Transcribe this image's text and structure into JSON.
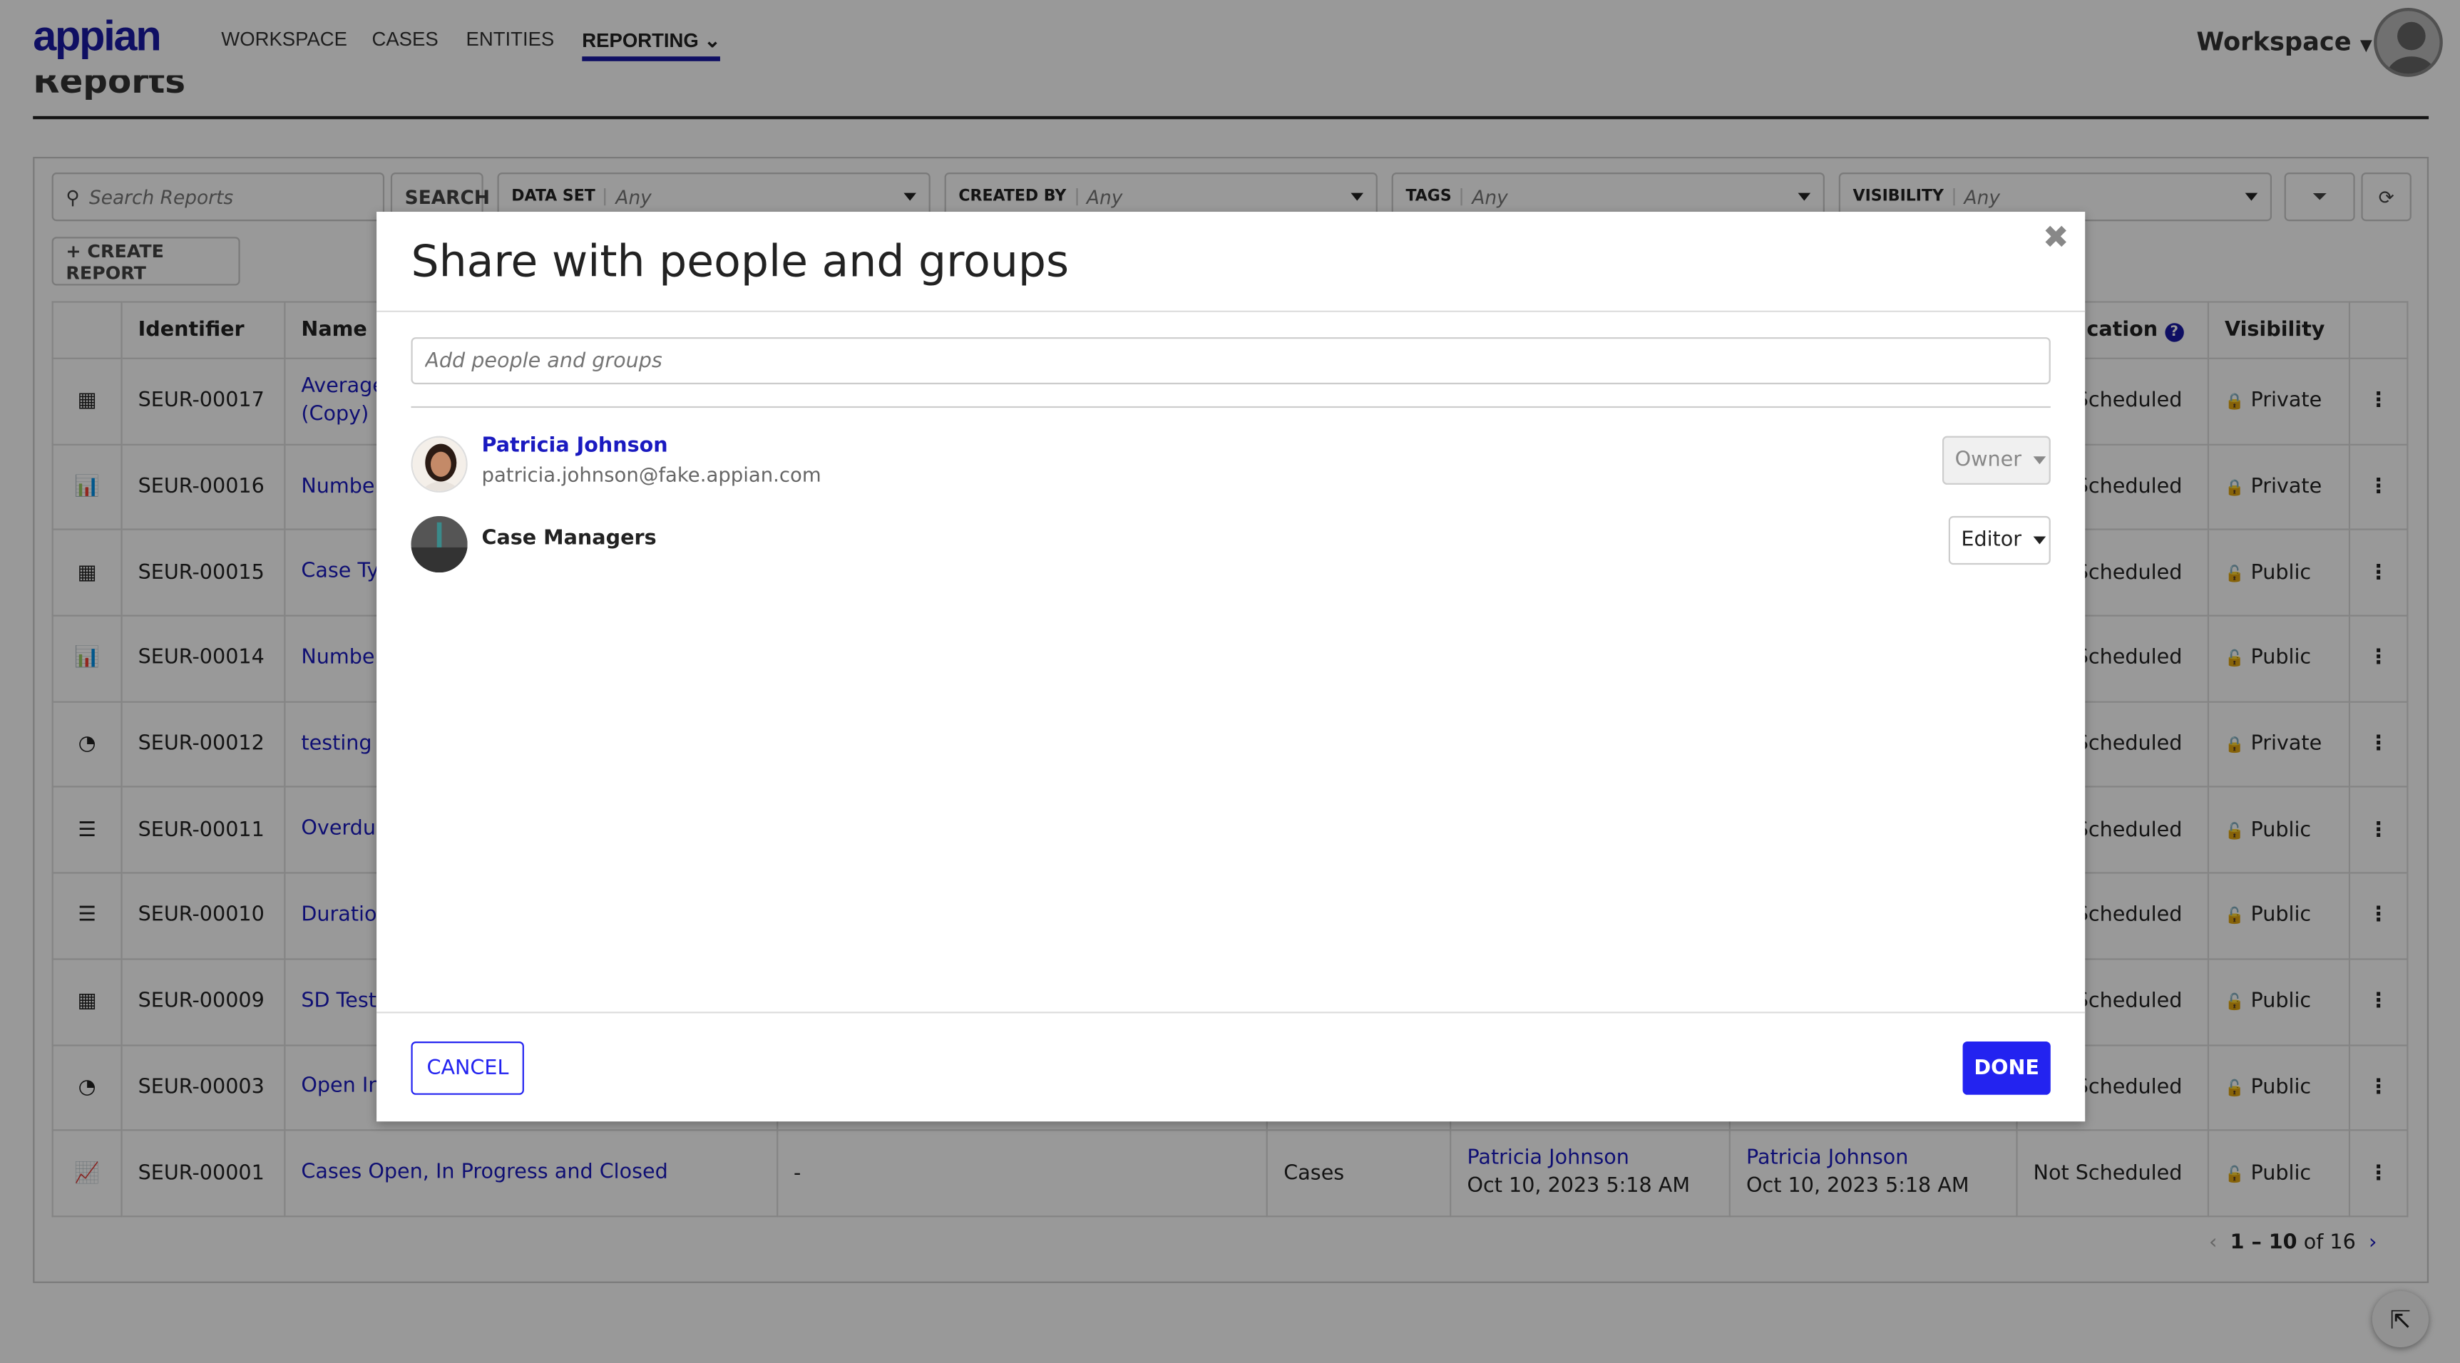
{
  "header": {
    "logo": "appian",
    "nav": [
      {
        "label": "WORKSPACE"
      },
      {
        "label": "CASES"
      },
      {
        "label": "ENTITIES"
      },
      {
        "label": "REPORTING"
      }
    ],
    "active_nav": "REPORTING",
    "workspace_label": "Workspace"
  },
  "page": {
    "title": "Reports"
  },
  "filters": {
    "search_placeholder": "Search Reports",
    "search_button": "SEARCH",
    "data_set": {
      "label": "DATA SET",
      "value": "Any"
    },
    "created_by": {
      "label": "CREATED BY",
      "value": "Any"
    },
    "tags": {
      "label": "TAGS",
      "value": "Any"
    },
    "visibility": {
      "label": "VISIBILITY",
      "value": "Any"
    },
    "create_button": "+ CREATE REPORT"
  },
  "table": {
    "headers": {
      "identifier": "Identifier",
      "name": "Name",
      "notification": "cation",
      "visibility": "Visibility"
    },
    "rows": [
      {
        "icon": "grid",
        "id": "SEUR-00017",
        "name": "Average",
        "name2": "(Copy)",
        "schedule": "Not Scheduled",
        "visibility": "Private"
      },
      {
        "icon": "bar",
        "id": "SEUR-00016",
        "name": "Number",
        "schedule": "Not Scheduled",
        "visibility": "Private"
      },
      {
        "icon": "grid",
        "id": "SEUR-00015",
        "name": "Case Typ",
        "schedule": "Not Scheduled",
        "visibility": "Public"
      },
      {
        "icon": "bar",
        "id": "SEUR-00014",
        "name": "Number",
        "schedule": "Not Scheduled",
        "visibility": "Public"
      },
      {
        "icon": "pie",
        "id": "SEUR-00012",
        "name": "testing r",
        "schedule": "Not Scheduled",
        "visibility": "Private"
      },
      {
        "icon": "list",
        "id": "SEUR-00011",
        "name": "Overdue",
        "schedule": "Not Scheduled",
        "visibility": "Public"
      },
      {
        "icon": "list",
        "id": "SEUR-00010",
        "name": "Duration",
        "schedule": "Not Scheduled",
        "visibility": "Public"
      },
      {
        "icon": "grid",
        "id": "SEUR-00009",
        "name": "SD Test",
        "schedule": "Not Scheduled",
        "visibility": "Public"
      },
      {
        "icon": "pie",
        "id": "SEUR-00003",
        "name": "Open In",
        "schedule": "Not Scheduled",
        "visibility": "Public"
      },
      {
        "icon": "line",
        "id": "SEUR-00001",
        "name": "Cases Open, In Progress and Closed",
        "description": "-",
        "data_set": "Cases",
        "created_by": "Patricia Johnson",
        "created_on": "Oct 10, 2023 5:18 AM",
        "modified_by": "Patricia Johnson",
        "modified_on": "Oct 10, 2023 5:18 AM",
        "schedule": "Not Scheduled",
        "visibility": "Public"
      }
    ],
    "pager": {
      "range": "1 – 10",
      "of": "of 16"
    }
  },
  "modal": {
    "title": "Share with people and groups",
    "input_placeholder": "Add people and groups",
    "entries": [
      {
        "name": "Patricia Johnson",
        "email": "patricia.johnson@fake.appian.com",
        "role": "Owner"
      },
      {
        "name": "Case Managers",
        "role": "Editor"
      }
    ],
    "cancel": "CANCEL",
    "done": "DONE"
  },
  "colors": {
    "brand": "#1a1aa6",
    "primary_button": "#2323f0",
    "public_lock": "#1a9a1a"
  }
}
